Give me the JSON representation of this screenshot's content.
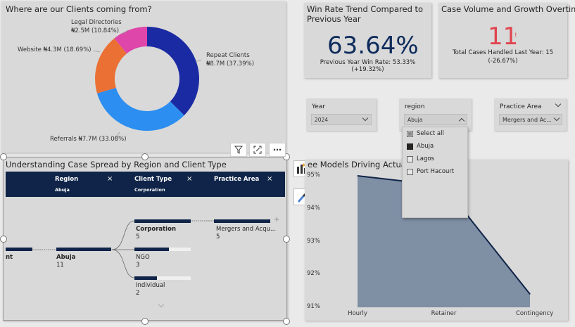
{
  "donut": {
    "title": "Where are our Clients coming from?",
    "labels": {
      "legal": "Legal Directories",
      "legal_val": "₦2.5M (10.84%)",
      "website": "Website ₦4.3M (18.69%)",
      "repeat": "Repeat Clients",
      "repeat_val": "₦8.7M (37.39%)",
      "referrals": "Referrals ₦7.7M (33.08%)"
    },
    "chart_data": {
      "type": "pie",
      "donut": true,
      "slices": [
        {
          "name": "Repeat Clients",
          "value": 8.7,
          "percent": 37.39,
          "color": "#1a2aa3"
        },
        {
          "name": "Referrals",
          "value": 7.7,
          "percent": 33.08,
          "color": "#2b8ef0"
        },
        {
          "name": "Website",
          "value": 4.3,
          "percent": 18.69,
          "color": "#ea7034"
        },
        {
          "name": "Legal Directories",
          "value": 2.5,
          "percent": 10.84,
          "color": "#de46aa"
        }
      ]
    }
  },
  "win": {
    "title_line1": "Win Rate Trend Compared to",
    "title_line2": "Previous Year",
    "value": "63.64%",
    "trend_icon": "✓",
    "subtext": "Previous Year Win Rate: 53.33% (+19.32%)"
  },
  "volume": {
    "title": "Case Volume and Growth Overtime",
    "value": "11",
    "alert_icon": "!",
    "subtext_line1": "Total Cases Handled Last Year: 15",
    "subtext_line2": "(-26.67%)"
  },
  "slicers": {
    "year": {
      "label": "Year",
      "value": "2024"
    },
    "region": {
      "label": "region",
      "value": "Abuja"
    },
    "practice": {
      "label": "Practice Area",
      "value": "Mergers and Ac..."
    }
  },
  "region_dropdown": {
    "items": [
      {
        "label": "Select all",
        "state": "partial"
      },
      {
        "label": "Abuja",
        "state": "on"
      },
      {
        "label": "Lagos",
        "state": "off"
      },
      {
        "label": "Port Hacourt",
        "state": "off"
      }
    ]
  },
  "decomp": {
    "title": "Understanding Case Spread by Region and Client Type",
    "headers": {
      "region": "Region",
      "region_val": "Abuja",
      "client": "Client Type",
      "client_val": "Corporation",
      "practice": "Practice Area",
      "close": "×"
    },
    "root_label": "nt",
    "abuja": {
      "name": "Abuja",
      "value": "11"
    },
    "corporation": {
      "name": "Corporation",
      "value": "5"
    },
    "ngo": {
      "name": "NGO",
      "value": "3"
    },
    "individual": {
      "name": "Individual",
      "value": "2"
    },
    "mergers": {
      "name": "Mergers and Acqu...",
      "value": "5"
    },
    "plus": "+"
  },
  "area": {
    "title": "ee Models Driving Actual R",
    "yticks": [
      "95%",
      "94%",
      "93%",
      "92%",
      "91%"
    ],
    "xticks": [
      "Hourly",
      "Retainer",
      "Contingency"
    ],
    "chart_data": {
      "type": "area",
      "categories": [
        "Hourly",
        "Retainer",
        "Contingency"
      ],
      "values": [
        95.0,
        94.7,
        91.4
      ],
      "ylim": [
        91,
        95
      ],
      "color": "#7f8fa4",
      "line_color": "#0f2448"
    }
  },
  "toolbar": {
    "filter_icon": "filter-icon",
    "focus_icon": "focus-mode-icon",
    "more": "⋯"
  }
}
